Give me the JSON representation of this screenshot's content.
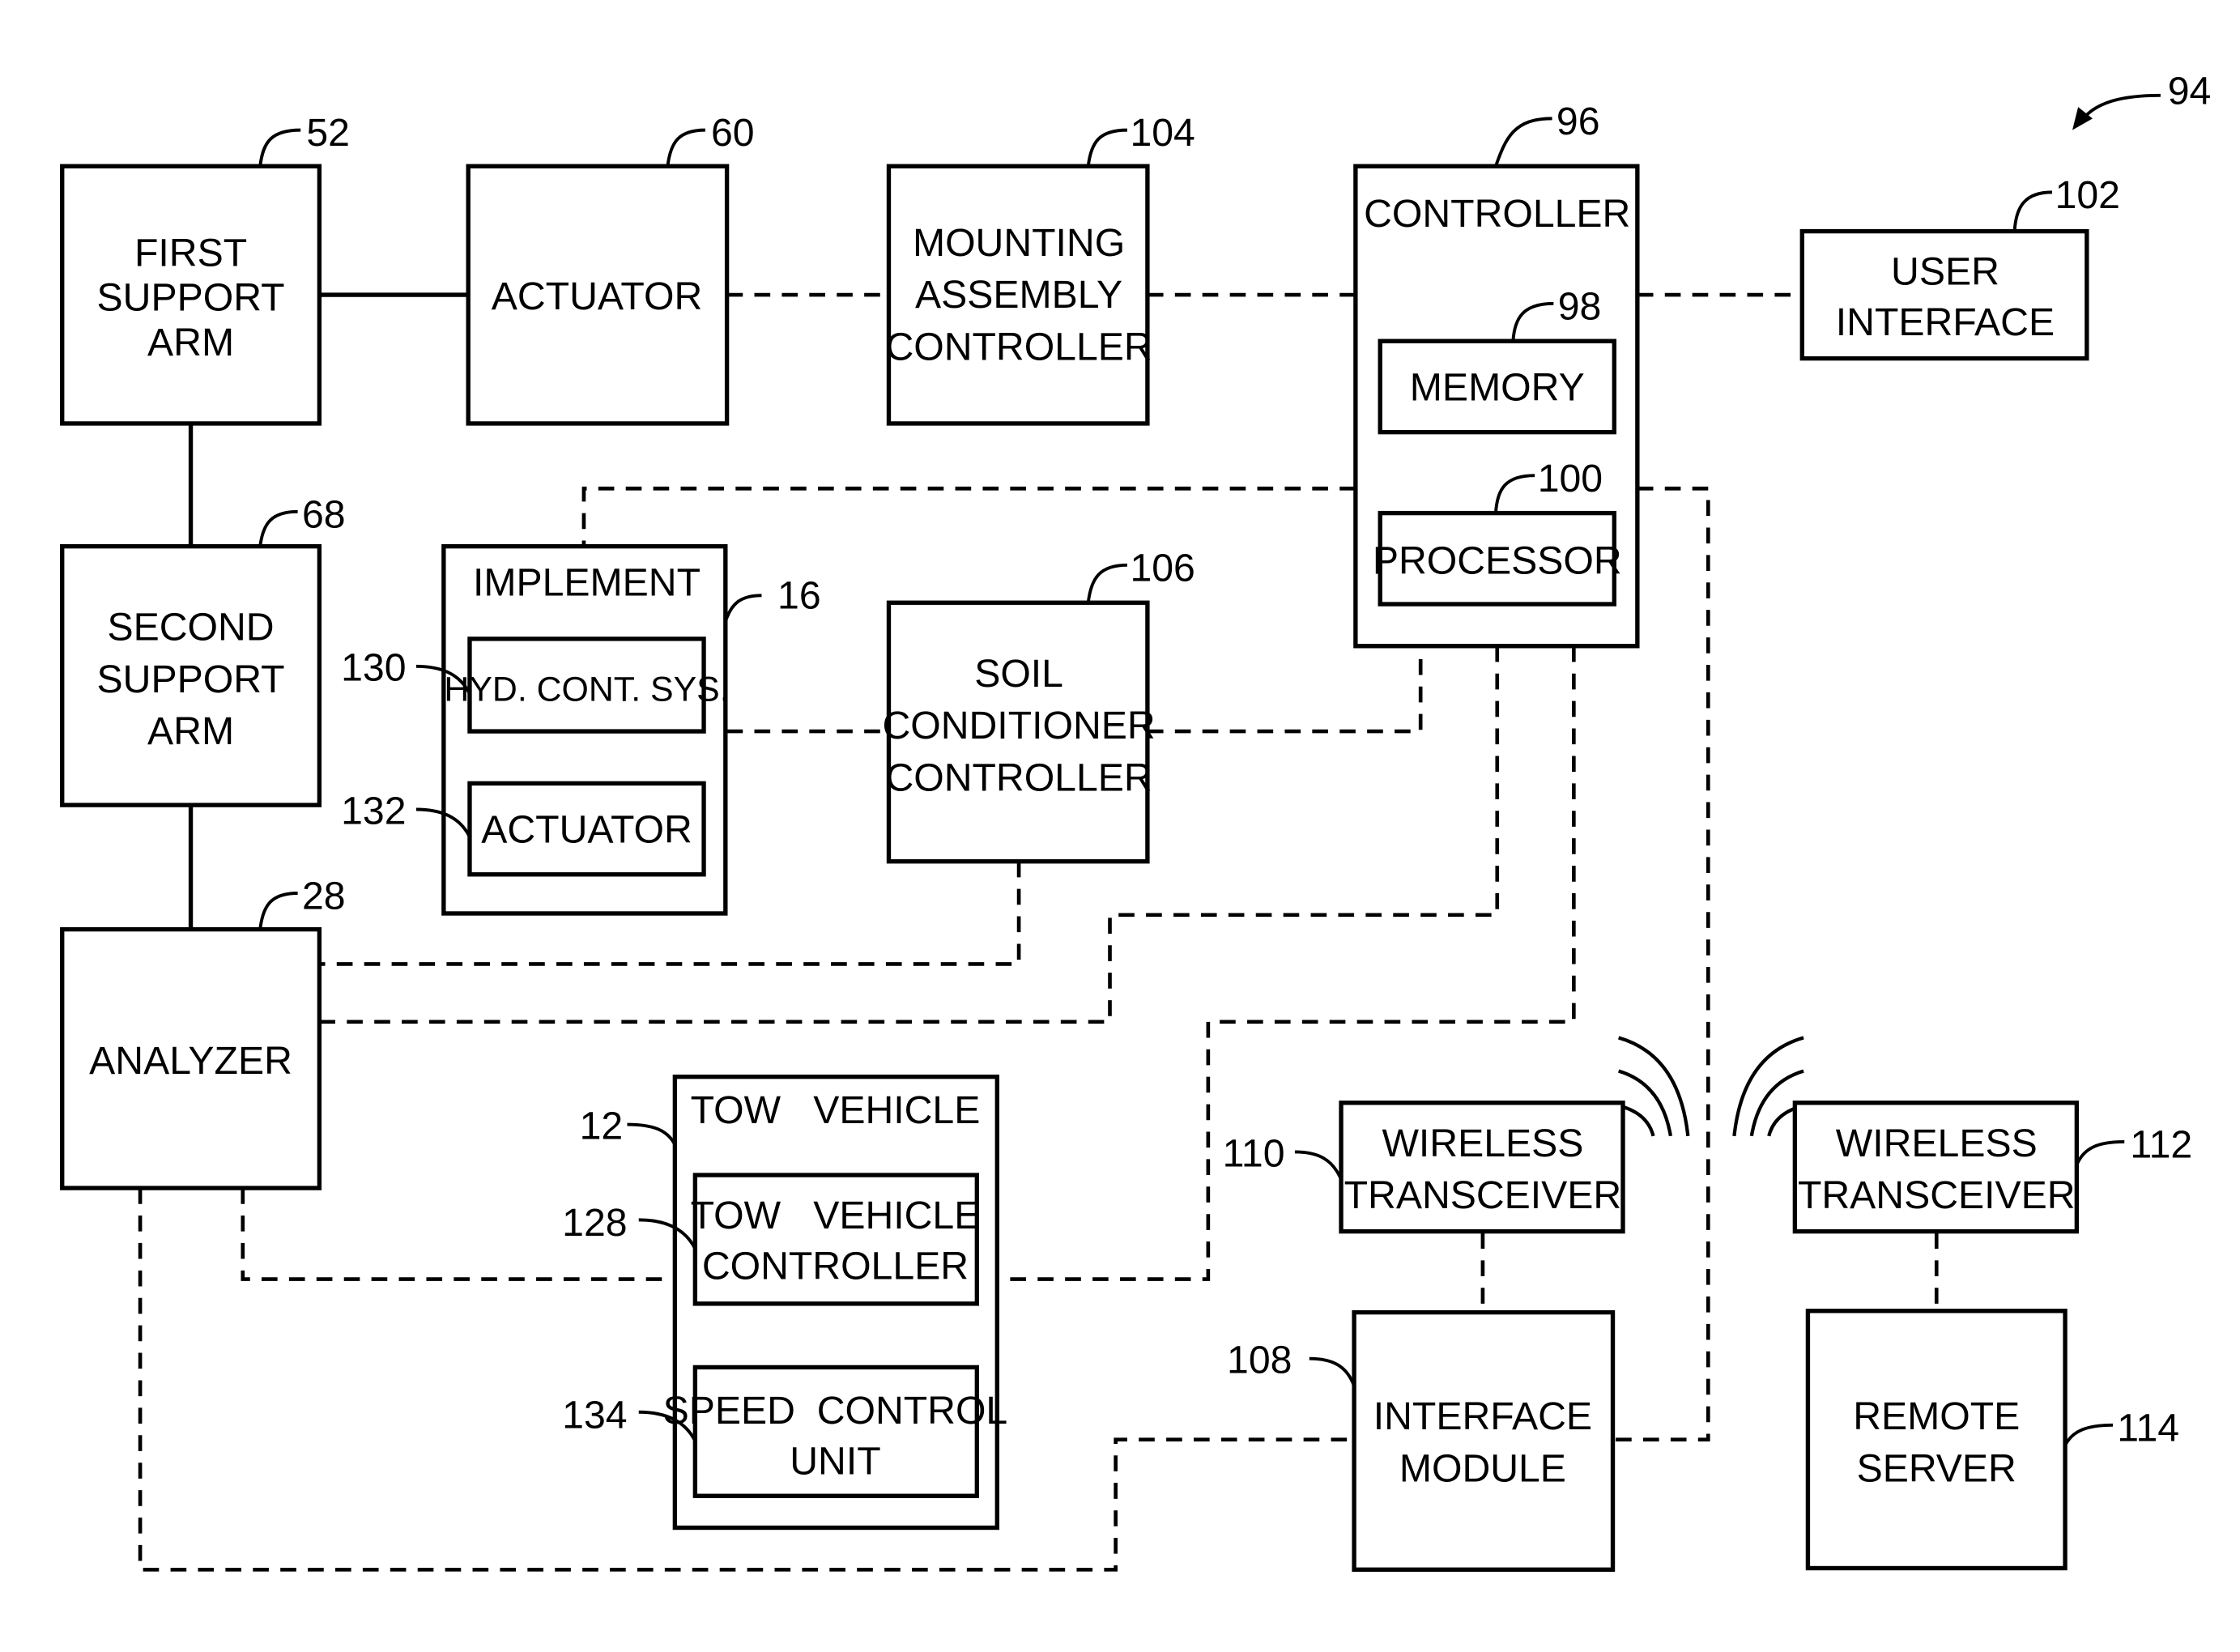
{
  "figure": {
    "figure_ref": "94",
    "blocks": {
      "first_support_arm": {
        "ref": "52",
        "lines": [
          "FIRST",
          "SUPPORT",
          "ARM"
        ]
      },
      "actuator_top": {
        "ref": "60",
        "lines": [
          "ACTUATOR"
        ]
      },
      "mounting_assembly_controller": {
        "ref": "104",
        "lines": [
          "MOUNTING",
          "ASSEMBLY",
          "CONTROLLER"
        ]
      },
      "controller": {
        "ref": "96",
        "lines": [
          "CONTROLLER"
        ]
      },
      "memory": {
        "ref": "98",
        "lines": [
          "MEMORY"
        ]
      },
      "processor": {
        "ref": "100",
        "lines": [
          "PROCESSOR"
        ]
      },
      "user_interface": {
        "ref": "102",
        "lines": [
          "USER",
          "INTERFACE"
        ]
      },
      "second_support_arm": {
        "ref": "68",
        "lines": [
          "SECOND",
          "SUPPORT",
          "ARM"
        ]
      },
      "implement": {
        "ref": "16",
        "lines": [
          "IMPLEMENT"
        ]
      },
      "hyd_cont_sys": {
        "ref": "130",
        "lines": [
          "HYD. CONT. SYS."
        ]
      },
      "implement_actuator": {
        "ref": "132",
        "lines": [
          "ACTUATOR"
        ]
      },
      "soil_conditioner_controller": {
        "ref": "106",
        "lines": [
          "SOIL",
          "CONDITIONER",
          "CONTROLLER"
        ]
      },
      "analyzer": {
        "ref": "28",
        "lines": [
          "ANALYZER"
        ]
      },
      "tow_vehicle": {
        "ref": "12",
        "lines": [
          "TOW   VEHICLE"
        ]
      },
      "tow_vehicle_controller": {
        "ref": "128",
        "lines": [
          "TOW   VEHICLE",
          "CONTROLLER"
        ]
      },
      "speed_control_unit": {
        "ref": "134",
        "lines": [
          "SPEED  CONTROL",
          "UNIT"
        ]
      },
      "wireless_transceiver_local": {
        "ref": "110",
        "lines": [
          "WIRELESS",
          "TRANSCEIVER"
        ]
      },
      "interface_module": {
        "ref": "108",
        "lines": [
          "INTERFACE",
          "MODULE"
        ]
      },
      "wireless_transceiver_remote": {
        "ref": "112",
        "lines": [
          "WIRELESS",
          "TRANSCEIVER"
        ]
      },
      "remote_server": {
        "ref": "114",
        "lines": [
          "REMOTE",
          "SERVER"
        ]
      }
    }
  }
}
